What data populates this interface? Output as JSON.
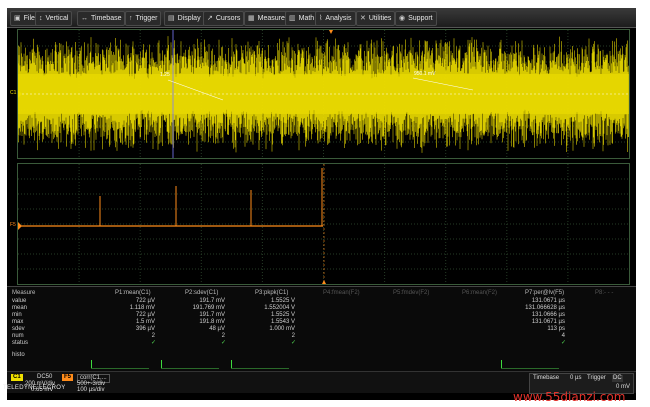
{
  "menu": [
    {
      "label": "File",
      "icon": "file-icon"
    },
    {
      "label": "Vertical",
      "icon": "vertical-icon"
    },
    {
      "label": "Timebase",
      "icon": "timebase-icon"
    },
    {
      "label": "Trigger",
      "icon": "trigger-icon"
    },
    {
      "label": "Display",
      "icon": "display-icon"
    },
    {
      "label": "Cursors",
      "icon": "cursors-icon"
    },
    {
      "label": "Measure",
      "icon": "measure-icon"
    },
    {
      "label": "Math",
      "icon": "math-icon"
    },
    {
      "label": "Analysis",
      "icon": "analysis-icon"
    },
    {
      "label": "Utilities",
      "icon": "utilities-icon"
    },
    {
      "label": "Support",
      "icon": "support-icon"
    }
  ],
  "measure": {
    "header_label": "Measure",
    "row_labels": [
      "value",
      "mean",
      "min",
      "max",
      "sdev",
      "num",
      "status",
      "histo"
    ],
    "columns": [
      {
        "header": "P1:mean(C1)",
        "values": [
          "722 µV",
          "1.118 mV",
          "722 µV",
          "1.5 mV",
          "396 µV",
          "2"
        ],
        "status": "check"
      },
      {
        "header": "P2:sdev(C1)",
        "values": [
          "191.7 mV",
          "191.769 mV",
          "191.7 mV",
          "191.8 mV",
          "48 µV",
          "2"
        ],
        "status": "check"
      },
      {
        "header": "P3:pkpk(C1)",
        "values": [
          "1.5525 V",
          "1.552004 V",
          "1.5525 V",
          "1.5543 V",
          "1.000 mV",
          "2"
        ],
        "status": "check"
      },
      {
        "header": "P4:fmean(F2)",
        "values": [],
        "status": ""
      },
      {
        "header": "P5:fmdev(F2)",
        "values": [],
        "status": ""
      },
      {
        "header": "P6:mean(F2)",
        "values": [],
        "status": ""
      },
      {
        "header": "P7:per@lv(F5)",
        "values": [
          "131.0671 µs",
          "131.066628 µs",
          "131.0666 µs",
          "131.0671 µs",
          "113 ps",
          "4"
        ],
        "status": "check"
      },
      {
        "header": "P8:- - -",
        "values": [],
        "status": ""
      }
    ]
  },
  "channel": {
    "badge": "C1",
    "coupling": "DC50",
    "vdiv": "200 mV/div",
    "offset": "0.65 mV",
    "color": "#f0e000"
  },
  "math": {
    "badge": "F5",
    "title": "corr(C1,...",
    "line1": "500+-3/div",
    "line2": "100 µs/div",
    "color": "#ff8c1a"
  },
  "timebase": {
    "label": "Timebase",
    "value1": "0 µs",
    "trigger_label": "Trigger",
    "trigger_mode": "DC",
    "value2": "0 mV"
  },
  "brand": "TELEDYNE LECROY",
  "watermark": "www.55dianzi.com",
  "trace_labels": {
    "top_left": "C1",
    "bot_left": "F5",
    "top_ann1": "1.25",
    "top_ann2": "950.1 mV"
  },
  "colors": {
    "ch1": "#f0e000",
    "math": "#ff8c1a",
    "grid": "#2f4f2f",
    "cursor": "#7c7cff"
  }
}
